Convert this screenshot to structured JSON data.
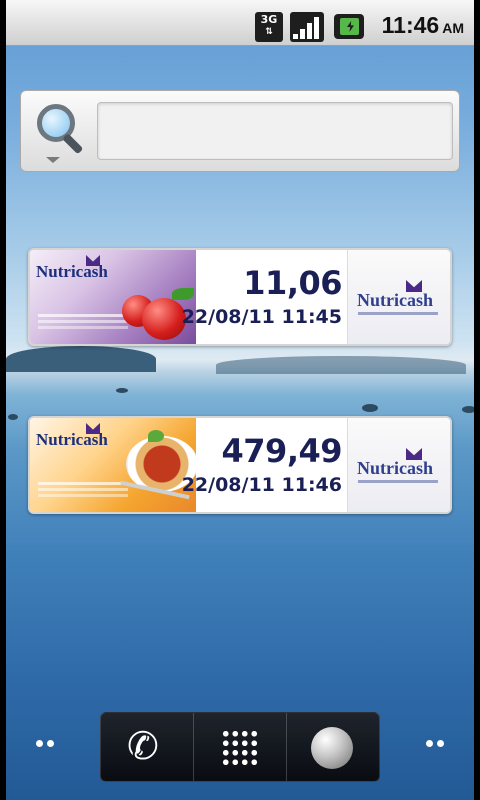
{
  "status_bar": {
    "network_label": "3G",
    "time": "11:46",
    "ampm": "AM"
  },
  "search": {
    "placeholder": ""
  },
  "widgets": [
    {
      "brand": "Nutricash",
      "value": "11,06",
      "timestamp": "22/08/11 11:45",
      "logo_text": "Nutricash",
      "theme": "refeição-maçã"
    },
    {
      "brand": "Nutricash",
      "value": "479,49",
      "timestamp": "22/08/11 11:46",
      "logo_text": "Nutricash",
      "theme": "refeição-prato"
    }
  ],
  "dock": {
    "phone_glyph": "✆",
    "items": [
      "phone-icon",
      "app-drawer-icon",
      "browser-icon"
    ]
  },
  "colors": {
    "value_text": "#1a1f55",
    "brand": "#2f3f8e"
  }
}
